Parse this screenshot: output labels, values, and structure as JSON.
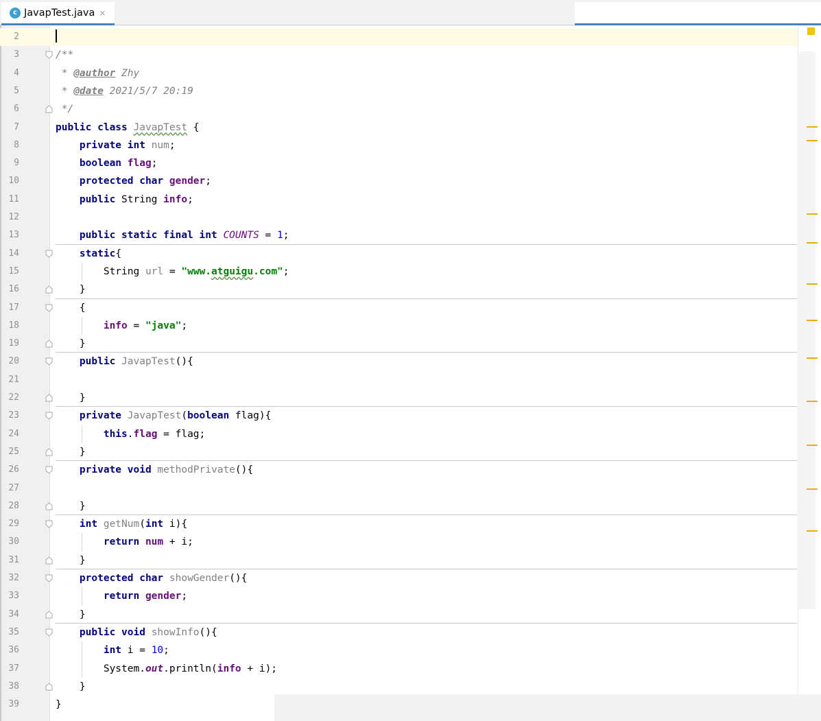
{
  "tab": {
    "icon_letter": "c",
    "title": "JavapTest.java",
    "close": "×"
  },
  "gutter": {
    "first_line": 2
  },
  "code": [
    {
      "n": "2",
      "t": []
    },
    {
      "n": "3",
      "t": [
        [
          "cm",
          "/**"
        ]
      ],
      "fold": "open"
    },
    {
      "n": "4",
      "t": [
        [
          "cm",
          " * "
        ],
        [
          "tag",
          "@author"
        ],
        [
          "cm",
          " Zhy"
        ]
      ]
    },
    {
      "n": "5",
      "t": [
        [
          "cm",
          " * "
        ],
        [
          "tag",
          "@date"
        ],
        [
          "cm",
          " 2021/5/7 20:19"
        ]
      ]
    },
    {
      "n": "6",
      "t": [
        [
          "cm",
          " */"
        ]
      ],
      "fold": "close"
    },
    {
      "n": "7",
      "t": [
        [
          "kw",
          "public class "
        ],
        [
          "grey squig",
          "JavapTest"
        ],
        [
          "",
          " {"
        ]
      ]
    },
    {
      "n": "8",
      "t": [
        [
          "",
          "    "
        ],
        [
          "kw",
          "private int "
        ],
        [
          "grey",
          "num"
        ],
        [
          "",
          ";"
        ]
      ]
    },
    {
      "n": "9",
      "t": [
        [
          "",
          "    "
        ],
        [
          "kw",
          "boolean "
        ],
        [
          "fld",
          "flag"
        ],
        [
          "",
          ";"
        ]
      ]
    },
    {
      "n": "10",
      "t": [
        [
          "",
          "    "
        ],
        [
          "kw",
          "protected char "
        ],
        [
          "fld",
          "gender"
        ],
        [
          "",
          ";"
        ]
      ]
    },
    {
      "n": "11",
      "t": [
        [
          "",
          "    "
        ],
        [
          "kw",
          "public "
        ],
        [
          "",
          "String "
        ],
        [
          "fld",
          "info"
        ],
        [
          "",
          ";"
        ]
      ]
    },
    {
      "n": "12",
      "t": []
    },
    {
      "n": "13",
      "t": [
        [
          "",
          "    "
        ],
        [
          "kw",
          "public static final int "
        ],
        [
          "const",
          "COUNTS"
        ],
        [
          "",
          " = "
        ],
        [
          "num",
          "1"
        ],
        [
          "",
          ";"
        ]
      ]
    },
    {
      "n": "14",
      "t": [
        [
          "",
          "    "
        ],
        [
          "kw",
          "static"
        ],
        [
          "",
          "{"
        ]
      ],
      "fold": "open"
    },
    {
      "n": "15",
      "t": [
        [
          "",
          "        String "
        ],
        [
          "grey",
          "url"
        ],
        [
          "",
          " = "
        ],
        [
          "st",
          "\"www."
        ],
        [
          "st squig",
          "atguigu"
        ],
        [
          "st",
          ".com\""
        ],
        [
          "",
          ";"
        ]
      ]
    },
    {
      "n": "16",
      "t": [
        [
          "",
          "    }"
        ]
      ],
      "fold": "close"
    },
    {
      "n": "17",
      "t": [
        [
          "",
          "    {"
        ]
      ],
      "fold": "open"
    },
    {
      "n": "18",
      "t": [
        [
          "",
          "        "
        ],
        [
          "fld",
          "info"
        ],
        [
          "",
          " = "
        ],
        [
          "st",
          "\"java\""
        ],
        [
          "",
          ";"
        ]
      ]
    },
    {
      "n": "19",
      "t": [
        [
          "",
          "    }"
        ]
      ],
      "fold": "close"
    },
    {
      "n": "20",
      "t": [
        [
          "",
          "    "
        ],
        [
          "kw",
          "public "
        ],
        [
          "grey",
          "JavapTest"
        ],
        [
          "",
          "(){"
        ]
      ],
      "fold": "open"
    },
    {
      "n": "21",
      "t": []
    },
    {
      "n": "22",
      "t": [
        [
          "",
          "    }"
        ]
      ],
      "fold": "close"
    },
    {
      "n": "23",
      "t": [
        [
          "",
          "    "
        ],
        [
          "kw",
          "private "
        ],
        [
          "grey",
          "JavapTest"
        ],
        [
          "",
          "("
        ],
        [
          "kw",
          "boolean "
        ],
        [
          "",
          "flag){"
        ]
      ],
      "fold": "open"
    },
    {
      "n": "24",
      "t": [
        [
          "",
          "        "
        ],
        [
          "kw",
          "this"
        ],
        [
          "",
          "."
        ],
        [
          "fld",
          "flag"
        ],
        [
          "",
          " = flag;"
        ]
      ]
    },
    {
      "n": "25",
      "t": [
        [
          "",
          "    }"
        ]
      ],
      "fold": "close"
    },
    {
      "n": "26",
      "t": [
        [
          "",
          "    "
        ],
        [
          "kw",
          "private void "
        ],
        [
          "grey",
          "methodPrivate"
        ],
        [
          "",
          "(){"
        ]
      ],
      "fold": "open"
    },
    {
      "n": "27",
      "t": []
    },
    {
      "n": "28",
      "t": [
        [
          "",
          "    }"
        ]
      ],
      "fold": "close"
    },
    {
      "n": "29",
      "t": [
        [
          "",
          "    "
        ],
        [
          "kw",
          "int "
        ],
        [
          "grey",
          "getNum"
        ],
        [
          "",
          "("
        ],
        [
          "kw",
          "int "
        ],
        [
          "",
          "i){"
        ]
      ],
      "fold": "open"
    },
    {
      "n": "30",
      "t": [
        [
          "",
          "        "
        ],
        [
          "kw",
          "return "
        ],
        [
          "fld",
          "num"
        ],
        [
          "",
          " + i;"
        ]
      ]
    },
    {
      "n": "31",
      "t": [
        [
          "",
          "    }"
        ]
      ],
      "fold": "close"
    },
    {
      "n": "32",
      "t": [
        [
          "",
          "    "
        ],
        [
          "kw",
          "protected char "
        ],
        [
          "grey",
          "showGender"
        ],
        [
          "",
          "(){"
        ]
      ],
      "fold": "open"
    },
    {
      "n": "33",
      "t": [
        [
          "",
          "        "
        ],
        [
          "kw",
          "return "
        ],
        [
          "fld",
          "gender"
        ],
        [
          "",
          ";"
        ]
      ]
    },
    {
      "n": "34",
      "t": [
        [
          "",
          "    }"
        ]
      ],
      "fold": "close"
    },
    {
      "n": "35",
      "t": [
        [
          "",
          "    "
        ],
        [
          "kw",
          "public void "
        ],
        [
          "grey",
          "showInfo"
        ],
        [
          "",
          "(){"
        ]
      ],
      "fold": "open"
    },
    {
      "n": "36",
      "t": [
        [
          "",
          "        "
        ],
        [
          "kw",
          "int "
        ],
        [
          "",
          "i = "
        ],
        [
          "num",
          "10"
        ],
        [
          "",
          ";"
        ]
      ]
    },
    {
      "n": "37",
      "t": [
        [
          "",
          "        System."
        ],
        [
          "static-m",
          "out"
        ],
        [
          "",
          ".println("
        ],
        [
          "fld",
          "info"
        ],
        [
          "",
          " + i);"
        ]
      ]
    },
    {
      "n": "38",
      "t": [
        [
          "",
          "    }"
        ]
      ],
      "fold": "close"
    },
    {
      "n": "39",
      "t": [
        [
          "",
          "}"
        ]
      ]
    }
  ],
  "colors": {
    "caret_line": "#fdfbe6",
    "keyword": "#000080",
    "field": "#660e7a",
    "string": "#008000",
    "number": "#0000ff",
    "marker": "#e5b100",
    "tab_accent": "#4083c9"
  }
}
